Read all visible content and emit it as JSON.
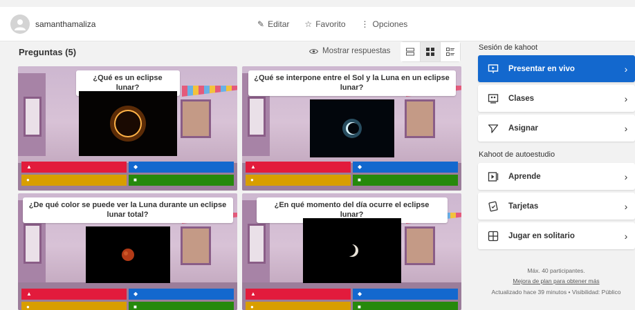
{
  "header": {
    "username": "samanthamaliza",
    "edit_label": "Editar",
    "favorite_label": "Favorito",
    "options_label": "Opciones"
  },
  "content": {
    "questions_title": "Preguntas (5)",
    "show_answers_label": "Mostrar respuestas"
  },
  "questions": [
    {
      "title": "¿Qué es un eclipse lunar?"
    },
    {
      "title": "¿Qué se interpone entre el Sol y la Luna en un eclipse lunar?"
    },
    {
      "title": "¿De qué color se puede ver la Luna durante un eclipse lunar total?"
    },
    {
      "title": "¿En qué momento del día ocurre el eclipse lunar?"
    }
  ],
  "answer_symbols": {
    "red": "▲",
    "blue": "◆",
    "yellow": "●",
    "green": "■"
  },
  "colors": {
    "primary": "#1368ce",
    "red": "#e21b3c",
    "blue": "#1368ce",
    "yellow": "#d89e00",
    "green": "#26890c"
  },
  "sidebar": {
    "session_title": "Sesión de kahoot",
    "present_live": "Presentar en vivo",
    "classes": "Clases",
    "assign": "Asignar",
    "selfstudy_title": "Kahoot de autoestudio",
    "learn": "Aprende",
    "cards": "Tarjetas",
    "solo": "Jugar en solitario",
    "max_participants": "Máx. 40 participantes.",
    "upgrade_link": "Mejora de plan para obtener más",
    "updated": "Actualizado hace 39 minutos • Visibilidad: Público"
  }
}
